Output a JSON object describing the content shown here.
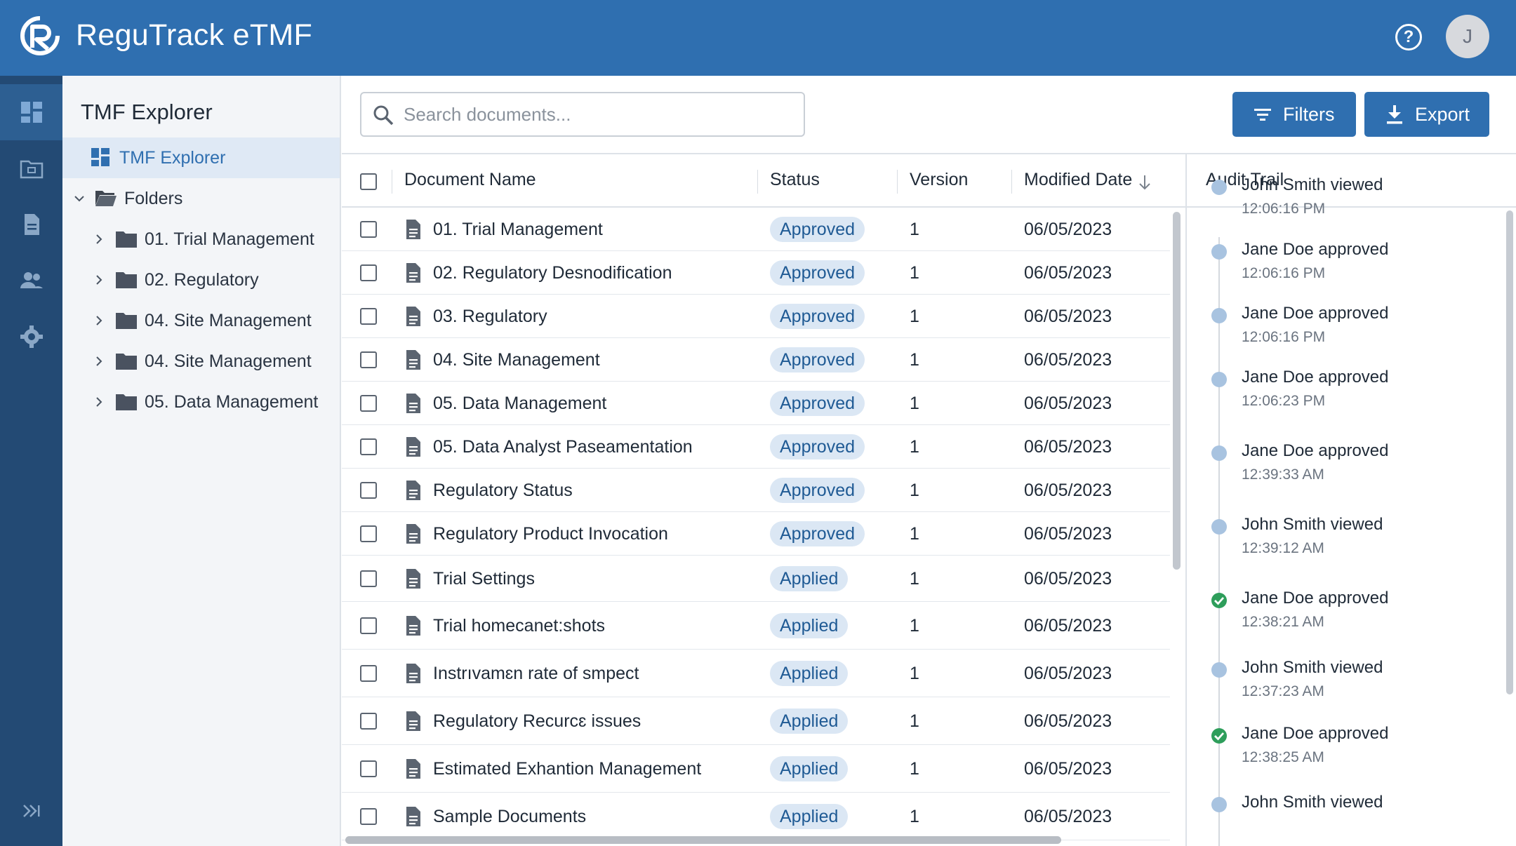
{
  "app": {
    "title": "ReguTrack eTMF",
    "avatar_initial": "J"
  },
  "header": {
    "help_icon": "help-circle-icon"
  },
  "rail": {
    "items": [
      {
        "name": "dashboard-icon",
        "active": true
      },
      {
        "name": "folder-icon",
        "active": false
      },
      {
        "name": "document-icon",
        "active": false
      },
      {
        "name": "users-icon",
        "active": false
      },
      {
        "name": "settings-icon",
        "active": false
      }
    ],
    "collapse_icon": "expand-sidebar-icon"
  },
  "explorer": {
    "title": "TMF Explorer",
    "root": "TMF Explorer",
    "folders_label": "Folders",
    "folders": [
      "01. Trial Management",
      "02. Regulatory",
      "04. Site Management",
      "04. Site Management",
      "05. Data Management"
    ]
  },
  "search": {
    "placeholder": "Search documents..."
  },
  "toolbar": {
    "filters_label": "Filters",
    "export_label": "Export"
  },
  "table": {
    "headers": {
      "name": "Document Name",
      "status": "Status",
      "version": "Version",
      "modified": "Modified Date"
    },
    "sort_icon": "arrow-down-icon",
    "rows": [
      {
        "name": "01. Trial Management",
        "status": "Approved",
        "version": "1",
        "date": "06/05/2023"
      },
      {
        "name": "02. Regulatory Desnodification",
        "status": "Approved",
        "version": "1",
        "date": "06/05/2023"
      },
      {
        "name": "03. Regulatory",
        "status": "Approved",
        "version": "1",
        "date": "06/05/2023"
      },
      {
        "name": "04. Site Management",
        "status": "Approved",
        "version": "1",
        "date": "06/05/2023"
      },
      {
        "name": "05. Data Management",
        "status": "Approved",
        "version": "1",
        "date": "06/05/2023"
      },
      {
        "name": "05. Data Analyst Paseamentation",
        "status": "Approved",
        "version": "1",
        "date": "06/05/2023"
      },
      {
        "name": "Regulatory Status",
        "status": "Approved",
        "version": "1",
        "date": "06/05/2023"
      },
      {
        "name": "Regulatory Product Invocation",
        "status": "Approved",
        "version": "1",
        "date": "06/05/2023"
      },
      {
        "name": "Trial Settings",
        "status": "Applied",
        "version": "1",
        "date": "06/05/2023"
      },
      {
        "name": "Trial homecanet:shots",
        "status": "Applied",
        "version": "1",
        "date": "06/05/2023"
      },
      {
        "name": "Instrıvamɛn rate of smpect",
        "status": "Applied",
        "version": "1",
        "date": "06/05/2023"
      },
      {
        "name": "Regulatory Recurcɛ issues",
        "status": "Applied",
        "version": "1",
        "date": "06/05/2023"
      },
      {
        "name": "Estimated Exhantion Management",
        "status": "Applied",
        "version": "1",
        "date": "06/05/2023"
      },
      {
        "name": "Sample Documents",
        "status": "Applied",
        "version": "1",
        "date": "06/05/2023"
      }
    ]
  },
  "audit": {
    "title": "Audit Trail",
    "entries": [
      {
        "action": "John Smith viewed",
        "time": "12:06:16 PM",
        "ok": false
      },
      {
        "action": "Jane Doe approved",
        "time": "12:06:16 PM",
        "ok": false
      },
      {
        "action": "Jane Doe approved",
        "time": "12:06:16 PM",
        "ok": false
      },
      {
        "action": "Jane Doe approved",
        "time": "12:06:23 PM",
        "ok": false
      },
      {
        "action": "Jane Doe approved",
        "time": "12:39:33 AM",
        "ok": false
      },
      {
        "action": "John Smith viewed",
        "time": "12:39:12 AM",
        "ok": false
      },
      {
        "action": "Jane Doe approved",
        "time": "12:38:21 AM",
        "ok": true
      },
      {
        "action": "John Smith viewed",
        "time": "12:37:23 AM",
        "ok": false
      },
      {
        "action": "Jane Doe approved",
        "time": "12:38:25 AM",
        "ok": true
      },
      {
        "action": "John Smith viewed",
        "time": "",
        "ok": false
      }
    ]
  },
  "colors": {
    "brand": "#2f6fb0",
    "rail": "#234a74",
    "badge_bg": "#dbe7f4",
    "ok": "#2e9e5b"
  }
}
